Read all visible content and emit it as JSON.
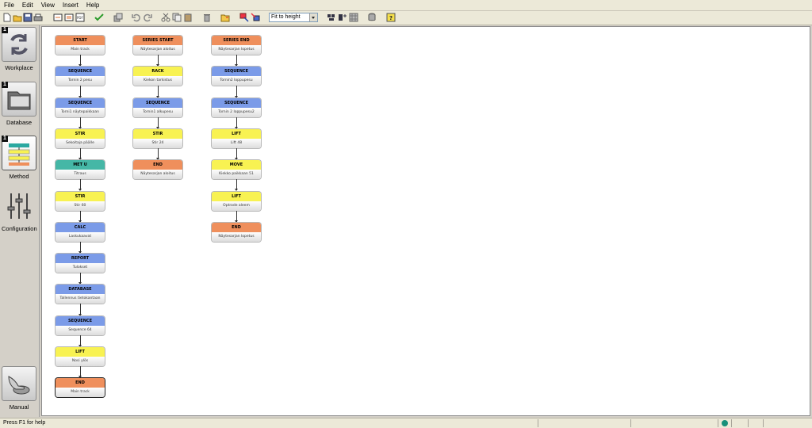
{
  "menu": [
    "File",
    "Edit",
    "View",
    "Insert",
    "Help"
  ],
  "toolbar": {
    "zoom_value": "Fit to height",
    "buttons": [
      "new-icon",
      "open-icon",
      "save-icon",
      "print-icon",
      "export-icon",
      "export-all-icon",
      "pdf-icon",
      "check-icon",
      "copy-block-icon",
      "undo-icon",
      "redo-icon",
      "cut-icon",
      "copy-icon",
      "paste-icon",
      "delete-icon",
      "folder-icon",
      "insert-icon",
      "replace-icon",
      "zoom-in-icon",
      "zoom-out-icon",
      "grid-icon",
      "database-icon",
      "help-icon"
    ]
  },
  "sidebar": [
    {
      "label": "Workplace",
      "badge": "1",
      "icon": "recycle-icon"
    },
    {
      "label": "Database",
      "badge": "1",
      "icon": "folder-icon"
    },
    {
      "label": "Method",
      "badge": "1",
      "icon": "method-icon"
    },
    {
      "label": "Configuration",
      "badge": "",
      "icon": "sliders-icon"
    },
    {
      "label": "Manual",
      "badge": "",
      "icon": "hand-icon"
    }
  ],
  "flow": {
    "column1": [
      {
        "type": "START",
        "text": "Main track",
        "kind": "start"
      },
      {
        "type": "SEQUENCE",
        "text": "Tornin 2 pesu",
        "kind": "blue"
      },
      {
        "type": "SEQUENCE",
        "text": "Torni1 näytepaikkaan",
        "kind": "blue"
      },
      {
        "type": "STIR",
        "text": "Sekoitaja päälle",
        "kind": "yellow"
      },
      {
        "type": "MET U",
        "text": "Titraus",
        "kind": "teal"
      },
      {
        "type": "STIR",
        "text": "Stir 60",
        "kind": "yellow"
      },
      {
        "type": "CALC",
        "text": "Laskukaavat",
        "kind": "blue"
      },
      {
        "type": "REPORT",
        "text": "Tulokset",
        "kind": "blue"
      },
      {
        "type": "DATABASE",
        "text": "Tallennus tietokantaan",
        "kind": "blue"
      },
      {
        "type": "SEQUENCE",
        "text": "Sequence 64",
        "kind": "blue"
      },
      {
        "type": "LIFT",
        "text": "Nosi ylös",
        "kind": "yellow"
      },
      {
        "type": "END",
        "text": "Main track",
        "kind": "end",
        "selected": true
      }
    ],
    "column2": [
      {
        "type": "SERIES START",
        "text": "Näytesarjan aloitus",
        "kind": "series"
      },
      {
        "type": "RACK",
        "text": "Kiekon tarkistus",
        "kind": "yellow"
      },
      {
        "type": "SEQUENCE",
        "text": "Tornin1 alkupesu",
        "kind": "blue"
      },
      {
        "type": "STIR",
        "text": "Stir 24",
        "kind": "yellow"
      },
      {
        "type": "END",
        "text": "Näytesarjan aloitus",
        "kind": "end"
      }
    ],
    "column3": [
      {
        "type": "SERIES END",
        "text": "Näytesarjan lopetus",
        "kind": "series"
      },
      {
        "type": "SEQUENCE",
        "text": "Tornin2 loppupesu",
        "kind": "blue"
      },
      {
        "type": "SEQUENCE",
        "text": "Tornin 2 loppupesu2",
        "kind": "blue"
      },
      {
        "type": "LIFT",
        "text": "Lift 48",
        "kind": "yellow"
      },
      {
        "type": "MOVE",
        "text": "Kiekko paikkaan 51",
        "kind": "yellow"
      },
      {
        "type": "LIFT",
        "text": "Optrode aleem",
        "kind": "yellow"
      },
      {
        "type": "END",
        "text": "Näytesarjan lopetus",
        "kind": "end"
      }
    ]
  },
  "status": {
    "text": "Press F1 for help",
    "indicator_color": "#16907a"
  }
}
